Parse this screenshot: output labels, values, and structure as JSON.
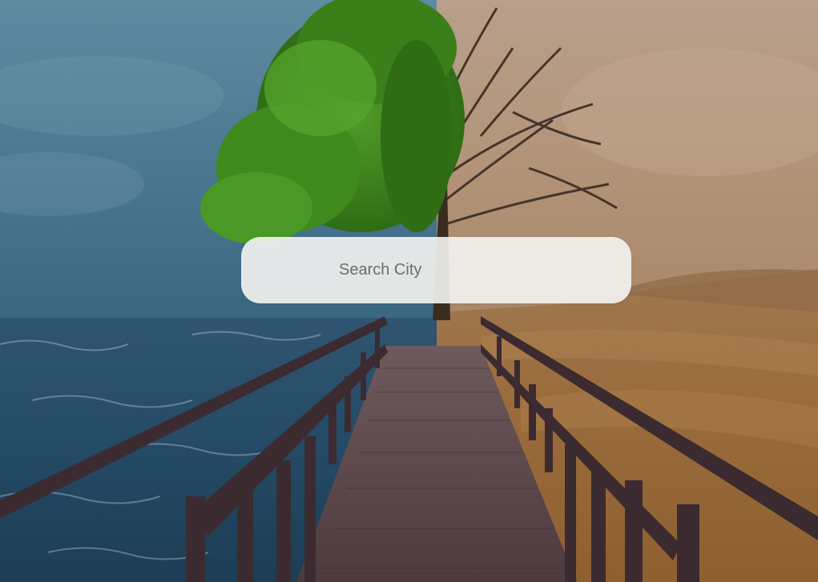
{
  "search": {
    "placeholder": "Search City",
    "value": ""
  },
  "background": {
    "description_icon": "split-weather-scene",
    "colors": {
      "stormy_sky": "#3e6d86",
      "ocean": "#1e3f58",
      "desert_sky": "#b08c6c",
      "sand": "#a06f3c",
      "boardwalk": "#5a4348",
      "tree_green": "#3f8a1f"
    }
  }
}
